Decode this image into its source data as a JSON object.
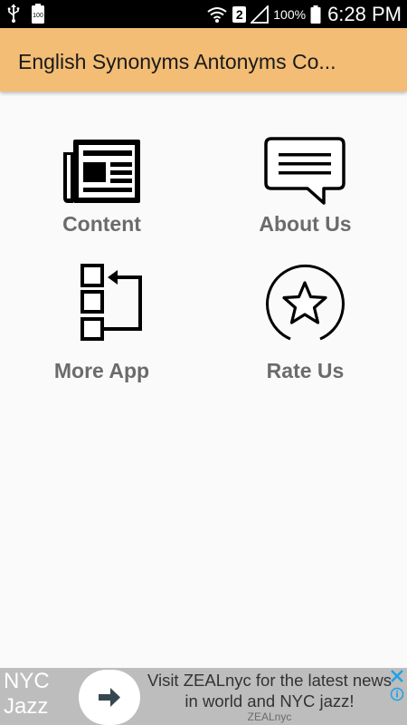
{
  "status_bar": {
    "battery_small_label": "100",
    "sim_slot": "2",
    "battery_percent": "100%",
    "time": "6:28 PM"
  },
  "app_bar": {
    "title": "English Synonyms Antonyms Co..."
  },
  "menu": {
    "items": [
      {
        "label": "Content",
        "icon": "newspaper-icon"
      },
      {
        "label": "About Us",
        "icon": "chat-bubble-icon"
      },
      {
        "label": "More App",
        "icon": "workflow-icon"
      },
      {
        "label": "Rate Us",
        "icon": "star-circle-icon"
      }
    ]
  },
  "ad": {
    "brand": "NYC Jazz",
    "headline": "Visit ZEALnyc for the latest news in world and NYC jazz!",
    "sponsor": "ZEALnyc",
    "accent": "#1da1e8"
  },
  "colors": {
    "app_bar": "#f3bd75",
    "label": "#6b6b6b",
    "background": "#fafafa"
  }
}
